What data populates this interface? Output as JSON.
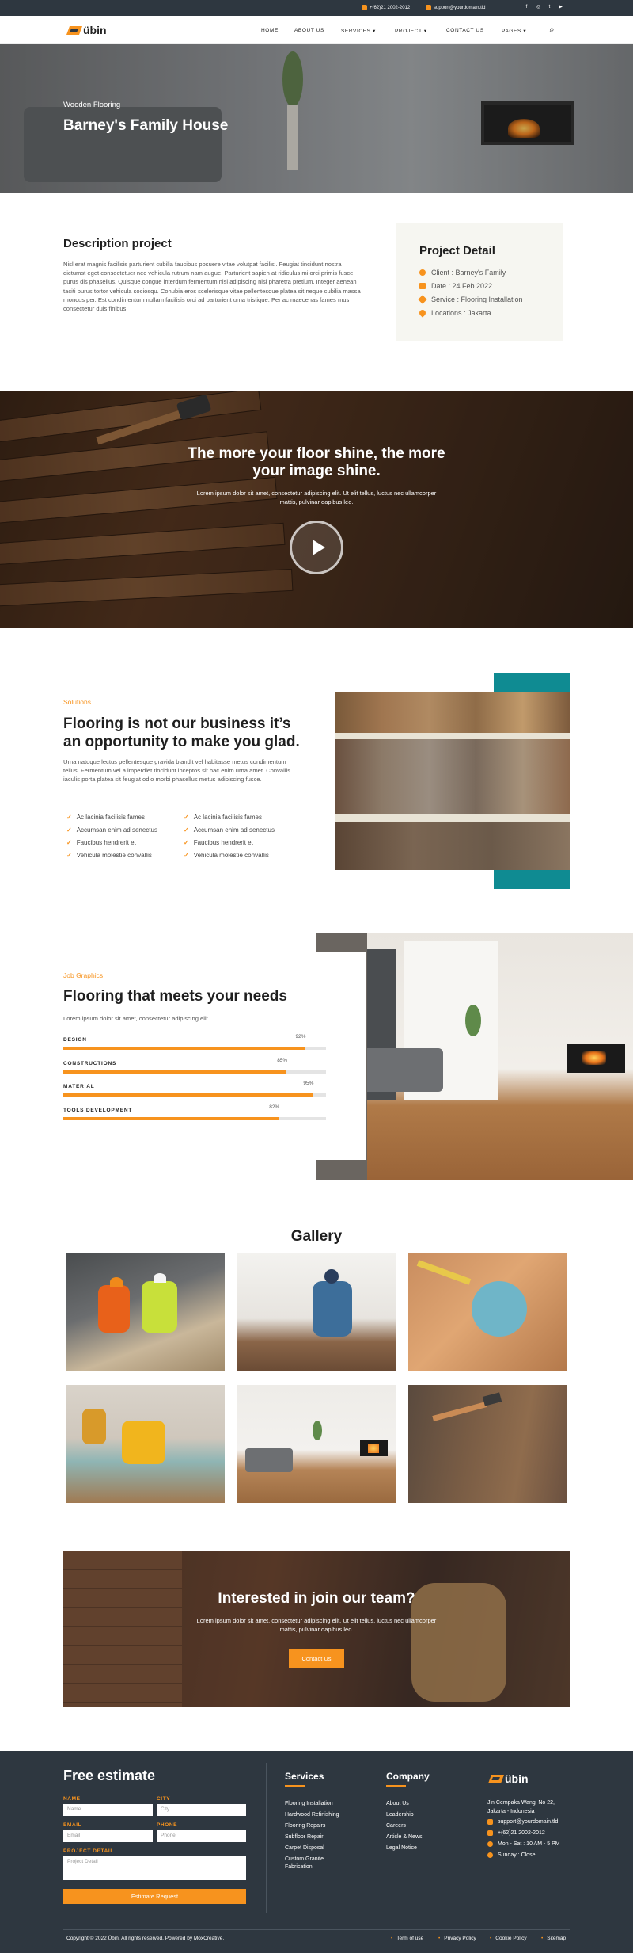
{
  "topbar": {
    "phone": "+(62)21 2002-2012",
    "email": "support@yourdomain.tld"
  },
  "brand": {
    "name": "übin"
  },
  "nav": {
    "home": "HOME",
    "about": "ABOUT US",
    "services": "SERVICES",
    "project": "PROJECT",
    "contact": "CONTACT US",
    "pages": "PAGES"
  },
  "hero": {
    "eyebrow": "Wooden Flooring",
    "title": "Barney's Family House"
  },
  "description": {
    "title": "Description project",
    "body": "Nisl erat magnis facilisis parturient cubilia faucibus posuere vitae volutpat facilisi. Feugiat tincidunt nostra dictumst eget consectetuer nec vehicula rutrum nam augue. Parturient sapien at ridiculus mi orci primis fusce purus dis phasellus. Quisque congue interdum fermentum nisi adipiscing nisi pharetra pretium. Integer aenean taciti purus tortor vehicula sociosqu. Conubia eros scelerisque vitae pellentesque platea sit neque cubilia massa rhoncus per. Est condimentum nullam facilisis orci ad parturient urna tristique. Per ac maecenas fames mus consectetur duis finibus."
  },
  "project_detail": {
    "title": "Project Detail",
    "client": "Client : Barney's Family",
    "date": "Date : 24 Feb 2022",
    "service": "Service : Flooring Installation",
    "location": "Locations : Jakarta"
  },
  "video_banner": {
    "title_line1": "The more your floor shine, the more",
    "title_line2": "your image shine.",
    "body_line1": "Lorem ipsum dolor sit amet, consectetur adipiscing elit. Ut elit tellus, luctus nec ullamcorper",
    "body_line2": "mattis, pulvinar dapibus leo."
  },
  "solutions": {
    "eyebrow": "Solutions",
    "title_line1": "Flooring is not our business it’s",
    "title_line2": "an opportunity to make you glad.",
    "body": "Urna natoque lectus pellentesque gravida blandit vel habitasse metus condimentum tellus. Fermentum vel a imperdiet tincidunt inceptos sit hac enim urna amet. Convallis iaculis porta platea sit feugiat odio morbi phasellus metus adipiscing fusce.",
    "list_left": [
      "Ac lacinia facilisis fames",
      "Accumsan enim ad senectus",
      "Faucibus hendrerit et",
      "Vehicula molestie convallis"
    ],
    "list_right": [
      "Ac lacinia facilisis fames",
      "Accumsan enim ad senectus",
      "Faucibus hendrerit et",
      "Vehicula molestie convallis"
    ]
  },
  "skills": {
    "eyebrow": "Job Graphics",
    "title": "Flooring that meets your needs",
    "body": "Lorem ipsum dolor sit amet, consectetur adipiscing elit.",
    "items": [
      {
        "label": "DESIGN",
        "pct": "92%",
        "value": 92
      },
      {
        "label": "CONSTRUCTIONS",
        "pct": "85%",
        "value": 85
      },
      {
        "label": "MATERIAL",
        "pct": "95%",
        "value": 95
      },
      {
        "label": "TOOLS DEVELOPMENT",
        "pct": "82%",
        "value": 82
      }
    ]
  },
  "gallery": {
    "title": "Gallery"
  },
  "cta": {
    "title": "Interested in join our team?",
    "body_line1": "Lorem ipsum dolor sit amet, consectetur adipiscing elit. Ut elit tellus, luctus nec ullamcorper",
    "body_line2": "mattis, pulvinar dapibus leo.",
    "button": "Contact Us"
  },
  "footer": {
    "estimate_title": "Free estimate",
    "name_label": "NAME",
    "name_ph": "Name",
    "city_label": "CITY",
    "city_ph": "City",
    "email_label": "EMAIL",
    "email_ph": "Email",
    "phone_label": "PHONE",
    "phone_ph": "Phone",
    "detail_label": "PROJECT DETAIL",
    "detail_ph": "Project Detail",
    "submit": "Estimate Request",
    "services_title": "Services",
    "services": [
      "Flooring Installation",
      "Hardwood Refinishing",
      "Flooring Repairs",
      "Subfloor Repair",
      "Carpet Disposal",
      "Custom Granite",
      "Fabrication"
    ],
    "company_title": "Company",
    "company": [
      "About Us",
      "Leadership",
      "Careers",
      "Article & News",
      "Legal Notice"
    ],
    "address_line1": "Jln Cempaka Wangi No 22,",
    "address_line2": "Jakarta - Indonesia",
    "email": "support@yourdomain.tld",
    "phone": "+(62)21 2002-2012",
    "hours": "Mon - Sat : 10 AM - 5 PM",
    "sunday": "Sunday : Close",
    "copyright": "Copyright © 2022 Übin, All rights reserved. Powered by MoxCreative.",
    "bottom_links": [
      "Term of use",
      "Privacy Policy",
      "Cookie Policy",
      "Sitemap"
    ]
  }
}
